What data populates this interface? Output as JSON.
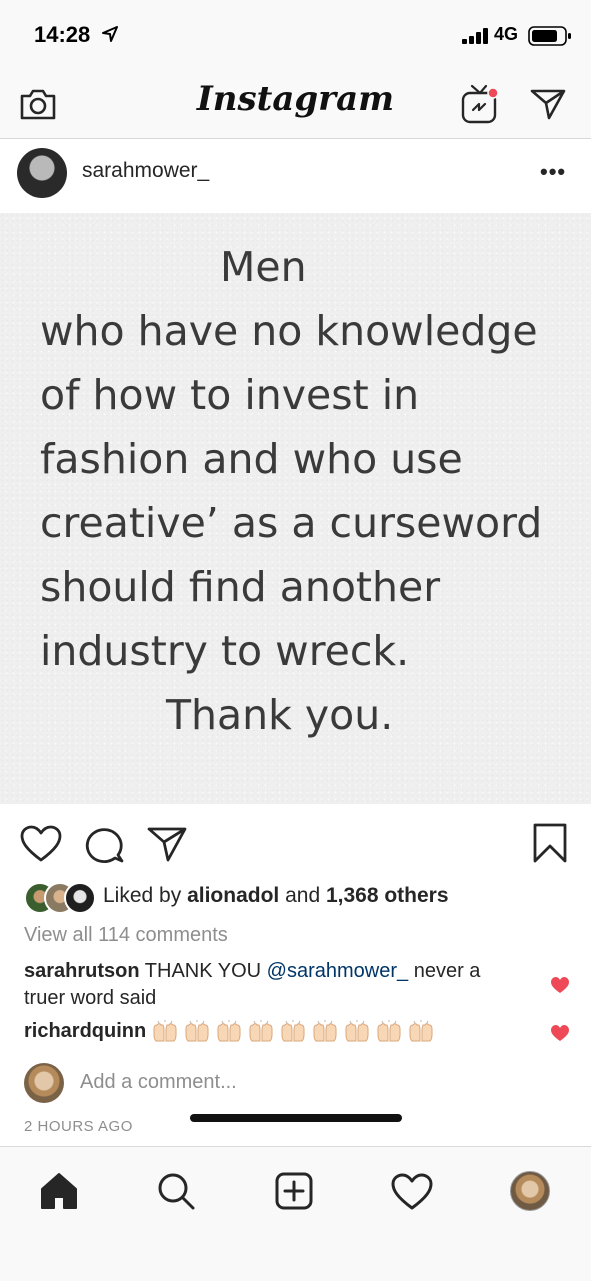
{
  "status_bar": {
    "time": "14:28",
    "network": "4G",
    "icons": [
      "location-arrow-icon",
      "signal-bars-icon",
      "battery-icon"
    ]
  },
  "top_nav": {
    "wordmark": "Instagram",
    "icons": [
      "camera-icon",
      "igtv-icon",
      "direct-message-icon"
    ],
    "igtv_badge_color": "#ed4956"
  },
  "post": {
    "username": "sarahmower_",
    "more_label": "•••",
    "image_text_lines": [
      "Men",
      "who have no knowledge",
      "of how to invest in",
      "fashion and who use",
      "creative’ as a curseword",
      "should find another",
      "industry to wreck.",
      "Thank you."
    ],
    "actions": [
      "heart-icon",
      "comment-icon",
      "share-icon",
      "bookmark-icon"
    ],
    "likes": {
      "prefix": "Liked by ",
      "first_liker": "alionadol",
      "middle": " and ",
      "others": "1,368 others"
    },
    "view_comments": "View all 114 comments",
    "comments": [
      {
        "username": "sarahrutson",
        "text_before": " THANK YOU ",
        "mention": "@sarahmower_",
        "text_after": "  never a truer word said",
        "liked": true
      },
      {
        "username": "richardquinn",
        "emoji": "raising-hands-icon",
        "emoji_count": 9,
        "liked": true
      }
    ],
    "add_comment_placeholder": "Add a comment...",
    "timestamp": "2 HOURS AGO"
  },
  "tab_bar": {
    "tabs": [
      "home-icon",
      "search-icon",
      "new-post-icon",
      "activity-heart-icon",
      "profile-avatar"
    ]
  },
  "colors": {
    "like_red": "#ed4956",
    "mention_blue": "#003569",
    "secondary_gray": "#8e8e8e"
  }
}
